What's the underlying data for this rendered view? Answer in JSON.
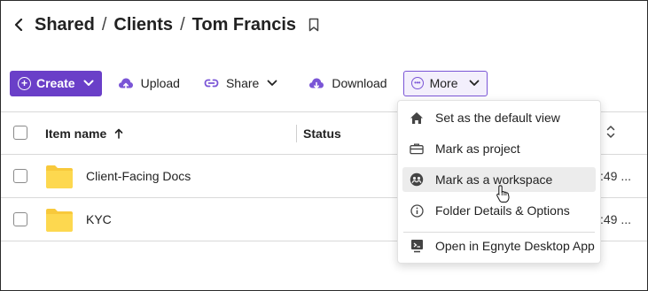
{
  "breadcrumb": {
    "back_icon": "chevron-left-icon",
    "items": [
      "Shared",
      "Clients",
      "Tom Francis"
    ],
    "separator": "/",
    "bookmark_icon": "bookmark-icon"
  },
  "toolbar": {
    "create_label": "Create",
    "upload_label": "Upload",
    "share_label": "Share",
    "download_label": "Download",
    "more_label": "More",
    "accent_color": "#6a3fc8"
  },
  "table": {
    "columns": [
      "Item name",
      "Status"
    ],
    "rows": [
      {
        "name": "Client-Facing Docs",
        "date_partial": ":49 ..."
      },
      {
        "name": "KYC",
        "date_partial": ":49 ..."
      }
    ]
  },
  "more_menu": {
    "items": [
      {
        "label": "Set as the default view",
        "icon": "home-icon"
      },
      {
        "label": "Mark as project",
        "icon": "briefcase-icon"
      },
      {
        "label": "Mark as a workspace",
        "icon": "workspace-icon",
        "hovered": true
      },
      {
        "label": "Folder Details & Options",
        "icon": "info-icon"
      },
      {
        "label": "Open in Egnyte Desktop App",
        "icon": "desktop-app-icon"
      }
    ]
  }
}
